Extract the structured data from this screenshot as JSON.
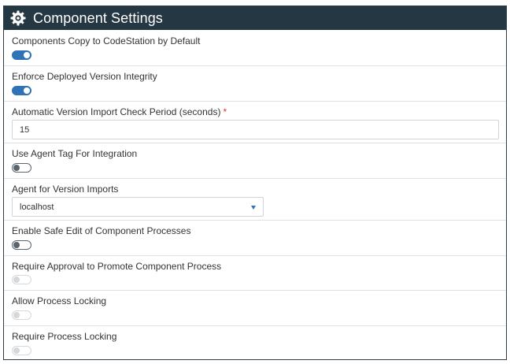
{
  "panel": {
    "title": "Component Settings",
    "icon": "gear-icon",
    "accent_color": "#2f73b7",
    "header_color": "#253742"
  },
  "settings": {
    "copy_to_codestation": {
      "label": "Components Copy to CodeStation by Default",
      "state": "on"
    },
    "enforce_integrity": {
      "label": "Enforce Deployed Version Integrity",
      "state": "on"
    },
    "import_check_period": {
      "label": "Automatic Version Import Check Period (seconds)",
      "required_marker": "*",
      "value": "15"
    },
    "use_agent_tag": {
      "label": "Use Agent Tag For Integration",
      "state": "off"
    },
    "agent_for_imports": {
      "label": "Agent for Version Imports",
      "selected": "localhost"
    },
    "safe_edit": {
      "label": "Enable Safe Edit of Component Processes",
      "state": "off"
    },
    "require_approval": {
      "label": "Require Approval to Promote Component Process",
      "state": "disabled-off"
    },
    "allow_locking": {
      "label": "Allow Process Locking",
      "state": "disabled-off"
    },
    "require_locking": {
      "label": "Require Process Locking",
      "state": "disabled-off"
    }
  }
}
